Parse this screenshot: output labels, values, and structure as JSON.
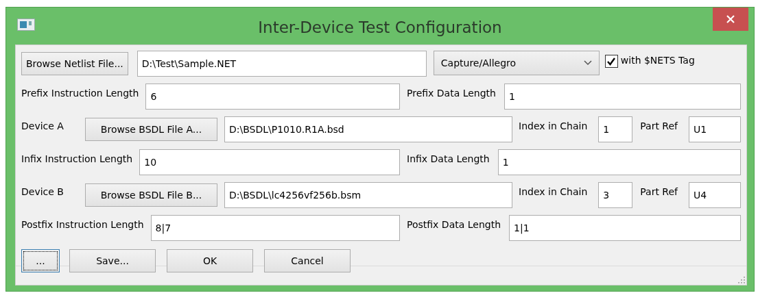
{
  "window": {
    "title": "Inter-Device Test Configuration"
  },
  "netlist": {
    "browse_button": "Browse Netlist File...",
    "path": "D:\\Test\\Sample.NET",
    "format": "Capture/Allegro",
    "nets_tag": {
      "label": "with $NETS Tag",
      "checked": true
    }
  },
  "sections": [
    {
      "kind": "lengths",
      "instruction_label": "Prefix Instruction Length",
      "instruction_value": "6",
      "data_label": "Prefix Data Length",
      "data_value": "1"
    },
    {
      "kind": "device",
      "label": "Device A",
      "browse_button": "Browse BSDL File A...",
      "path": "D:\\BSDL\\P1010.R1A.bsd",
      "index_label": "Index in Chain",
      "index_value": "1",
      "part_ref_label": "Part Ref",
      "part_ref_value": "U1"
    },
    {
      "kind": "lengths",
      "instruction_label": "Infix Instruction Length",
      "instruction_value": "10",
      "data_label": "Infix Data Length",
      "data_value": "1"
    },
    {
      "kind": "device",
      "label": "Device B",
      "browse_button": "Browse BSDL File B...",
      "path": "D:\\BSDL\\lc4256vf256b.bsm",
      "index_label": "Index in Chain",
      "index_value": "3",
      "part_ref_label": "Part Ref",
      "part_ref_value": "U4"
    },
    {
      "kind": "lengths",
      "instruction_label": "Postfix Instruction Length",
      "instruction_value": "8|7",
      "data_label": "Postfix Data Length",
      "data_value": "1|1"
    }
  ],
  "buttons": [
    {
      "label": "...",
      "focused": true
    },
    {
      "label": "Save...",
      "focused": false
    },
    {
      "label": "OK",
      "focused": false
    },
    {
      "label": "Cancel",
      "focused": false
    }
  ]
}
